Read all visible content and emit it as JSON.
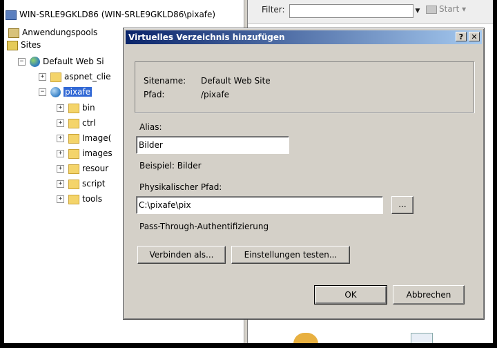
{
  "tree": {
    "server": "WIN-SRLE9GKLD86 (WIN-SRLE9GKLD86\\pixafe)",
    "app_pools": "Anwendungspools",
    "sites": "Sites",
    "default_site": "Default Web Si",
    "aspnet_client": "aspnet_clie",
    "pixafe": "pixafe",
    "children": [
      "bin",
      "ctrl",
      "Image(",
      "images",
      "resour",
      "script",
      "tools"
    ]
  },
  "right_pane": {
    "filter_label": "Filter:",
    "start_label": "Start"
  },
  "dialog": {
    "title": "Virtuelles Verzeichnis hinzufügen",
    "help_btn": "?",
    "close_btn": "✕",
    "sitename_label": "Sitename:",
    "sitename_value": "Default Web Site",
    "path_label": "Pfad:",
    "path_value": "/pixafe",
    "alias_label": "Alias:",
    "alias_value": "Bilder",
    "example_text": "Beispiel: Bilder",
    "physical_path_label": "Physikalischer Pfad:",
    "physical_path_value": "C:\\pixafe\\pix",
    "browse_btn": "...",
    "pass_through": "Pass-Through-Authentifizierung",
    "connect_as_btn": "Verbinden als...",
    "test_settings_btn": "Einstellungen testen...",
    "ok_btn": "OK",
    "cancel_btn": "Abbrechen"
  }
}
